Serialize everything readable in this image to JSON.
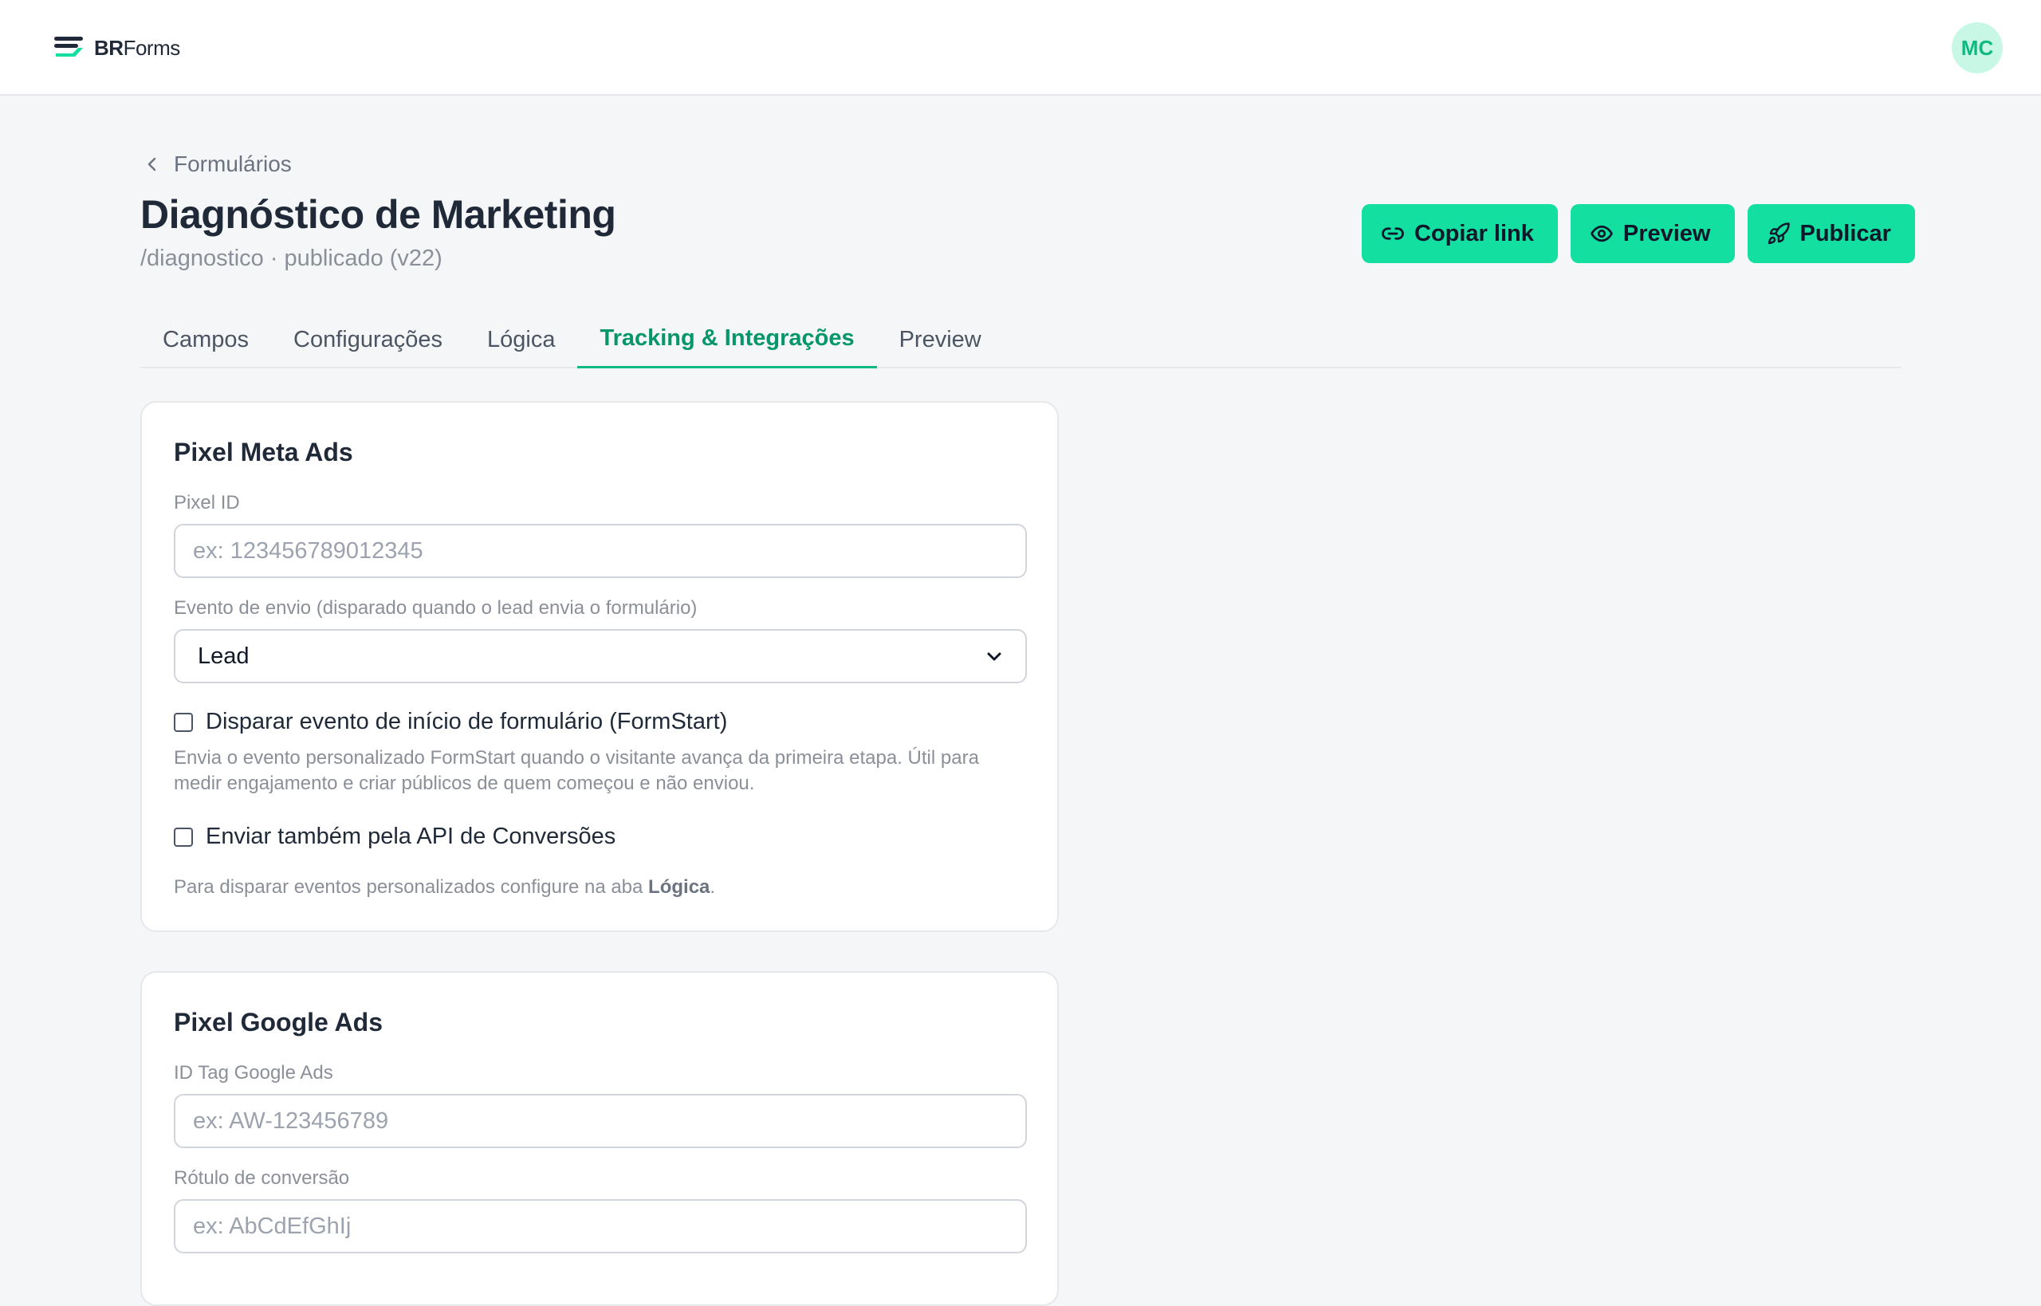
{
  "app": {
    "logo_strong": "BR",
    "logo_rest": "Forms",
    "avatar_initials": "MC",
    "brand_color": "#12dfa0"
  },
  "breadcrumb": {
    "back_label": "Formulários"
  },
  "header": {
    "title": "Diagnóstico de Marketing",
    "subtitle": "/diagnostico · publicado (v22)",
    "actions": {
      "copy_link": "Copiar link",
      "preview": "Preview",
      "publish": "Publicar"
    }
  },
  "tabs": [
    {
      "label": "Campos",
      "active": false
    },
    {
      "label": "Configurações",
      "active": false
    },
    {
      "label": "Lógica",
      "active": false
    },
    {
      "label": "Tracking & Integrações",
      "active": true
    },
    {
      "label": "Preview",
      "active": false
    }
  ],
  "meta_pixel": {
    "title": "Pixel Meta Ads",
    "pixel_id_label": "Pixel ID",
    "pixel_id_placeholder": "ex: 123456789012345",
    "pixel_id_value": "",
    "event_label": "Evento de envio (disparado quando o lead envia o formulário)",
    "event_value": "Lead",
    "formstart_label": "Disparar evento de início de formulário (FormStart)",
    "formstart_checked": false,
    "formstart_help": "Envia o evento personalizado FormStart quando o visitante avança da primeira etapa. Útil para medir engajamento e criar públicos de quem começou e não enviou.",
    "capi_label": "Enviar também pela API de Conversões",
    "capi_checked": false,
    "custom_events_help": "Para disparar eventos personalizados configure na aba",
    "custom_events_link": "Lógica",
    "custom_events_suffix": "."
  },
  "google_pixel": {
    "title": "Pixel Google Ads",
    "tag_label": "ID Tag Google Ads",
    "tag_placeholder": "ex: AW-123456789",
    "tag_value": "",
    "conversion_label": "Rótulo de conversão",
    "conversion_placeholder": "ex: AbCdEfGhIj",
    "conversion_value": ""
  }
}
